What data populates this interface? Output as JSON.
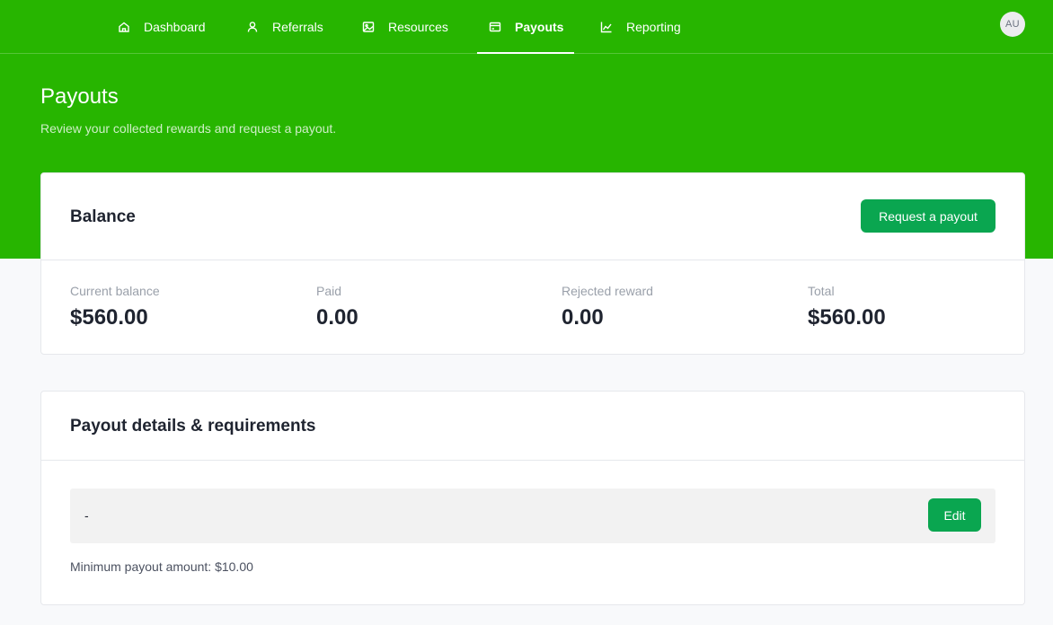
{
  "nav": {
    "items": [
      {
        "label": "Dashboard",
        "icon": "home-icon"
      },
      {
        "label": "Referrals",
        "icon": "user-icon"
      },
      {
        "label": "Resources",
        "icon": "image-icon"
      },
      {
        "label": "Payouts",
        "icon": "wallet-icon",
        "active": true
      },
      {
        "label": "Reporting",
        "icon": "chart-line-icon"
      }
    ],
    "avatar_initials": "AU"
  },
  "header": {
    "title": "Payouts",
    "subtitle": "Review your collected rewards and request a payout."
  },
  "balance": {
    "title": "Balance",
    "request_button": "Request a payout",
    "stats": [
      {
        "label": "Current balance",
        "value": "$560.00"
      },
      {
        "label": "Paid",
        "value": "0.00"
      },
      {
        "label": "Rejected reward",
        "value": "0.00"
      },
      {
        "label": "Total",
        "value": "$560.00"
      }
    ]
  },
  "details": {
    "title": "Payout details & requirements",
    "value": "-",
    "edit_button": "Edit",
    "min_payout": "Minimum payout amount: $10.00"
  },
  "colors": {
    "brand": "#27b500",
    "button": "#0aa650",
    "background": "#f8f9fb"
  }
}
